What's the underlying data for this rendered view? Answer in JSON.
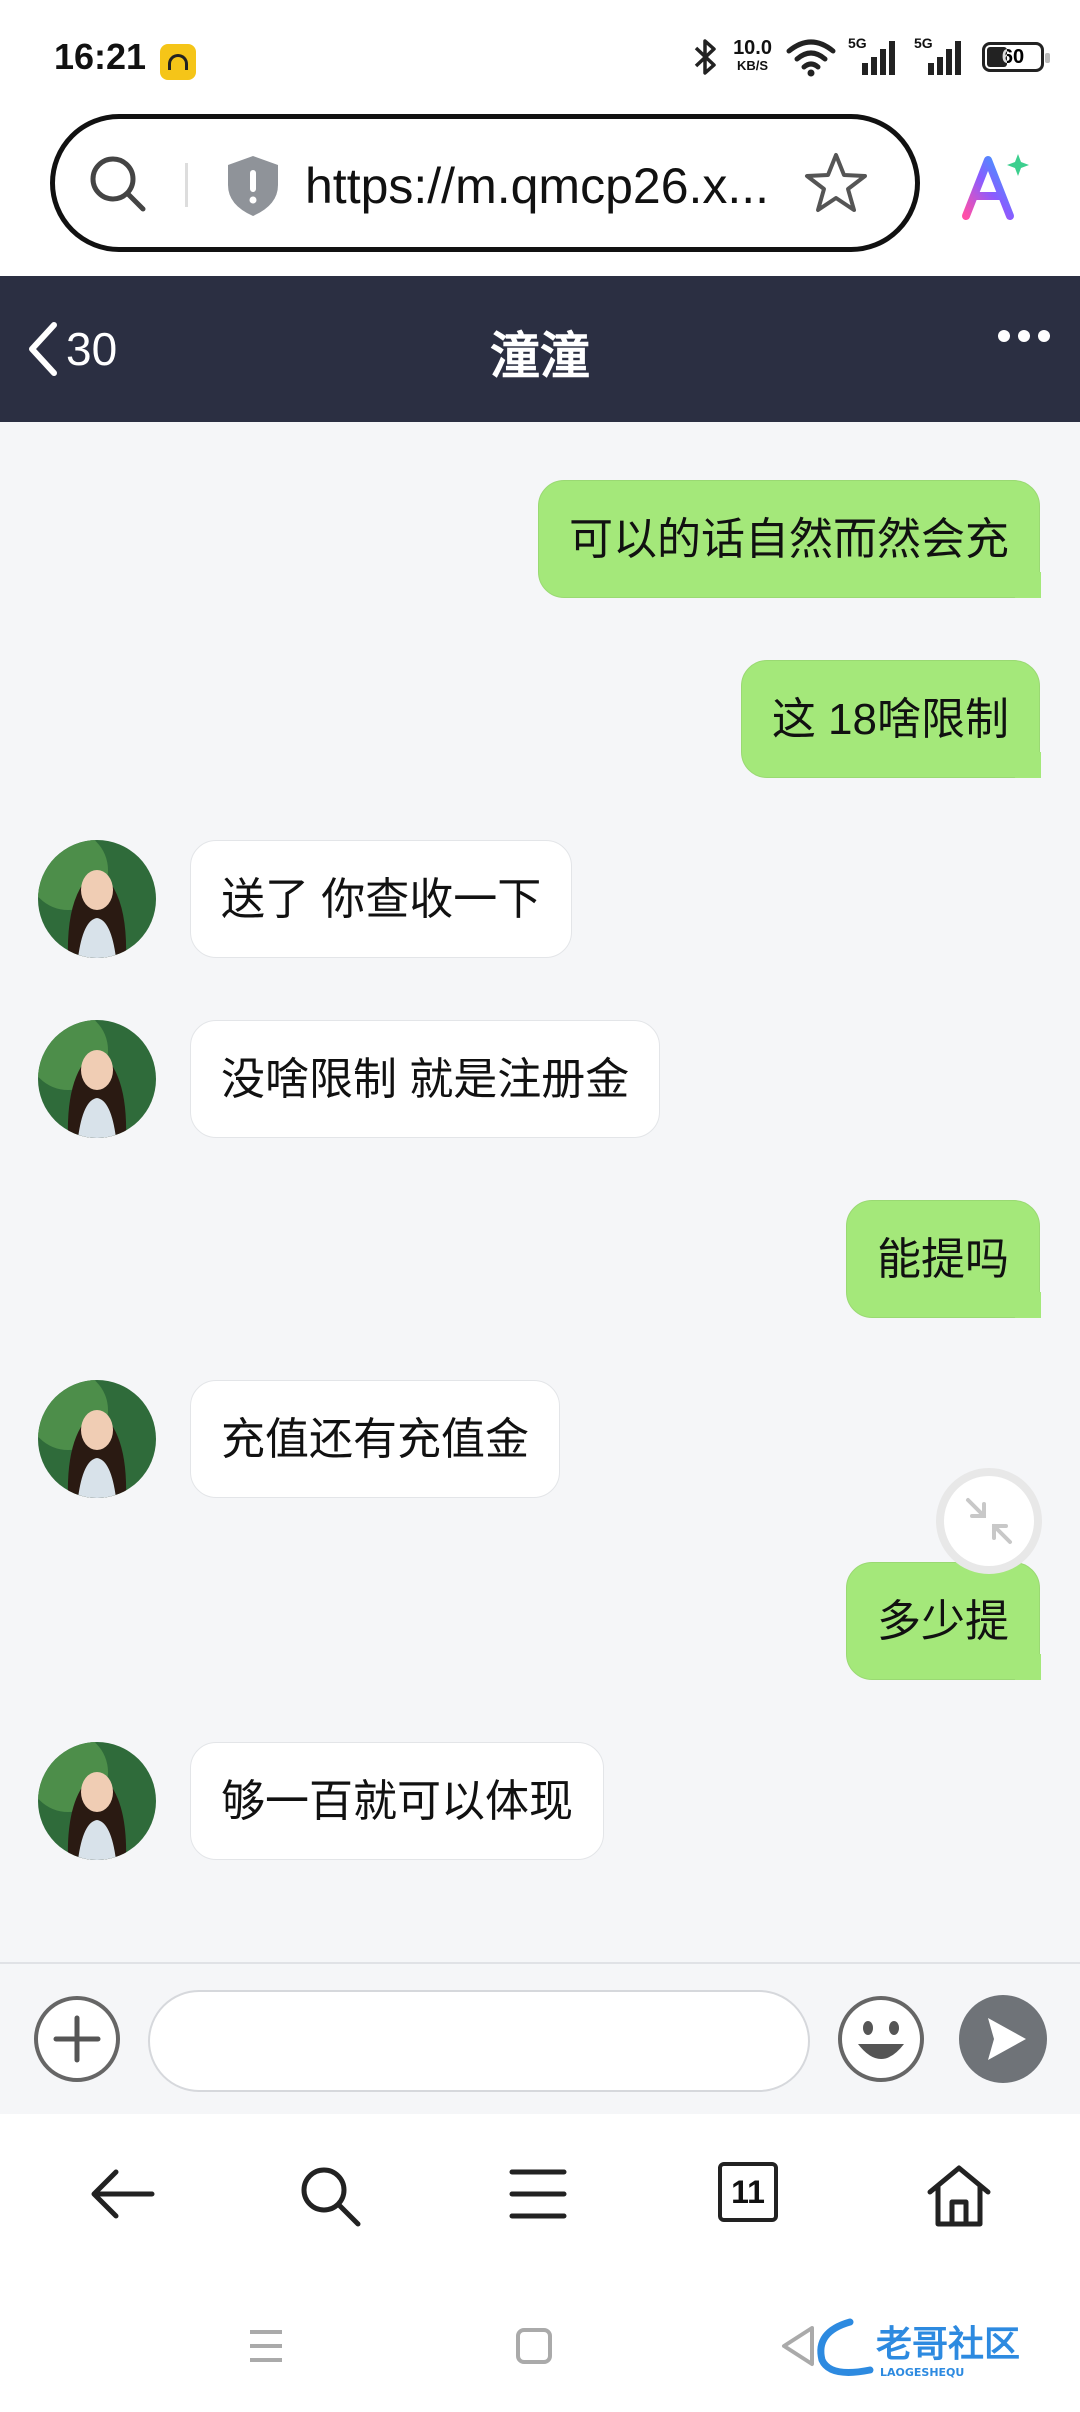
{
  "status_bar": {
    "time": "16:21",
    "network_speed": "10.0",
    "network_speed_unit": "KB/S",
    "signal1_label": "5G",
    "signal2_label": "5G",
    "battery": "60"
  },
  "browser": {
    "url": "https://m.qmcp26.x..."
  },
  "chat": {
    "back_count": "30",
    "title": "潼潼",
    "messages": [
      {
        "side": "me",
        "text": "可以的话自然而然会充"
      },
      {
        "side": "me",
        "text": "这 18啥限制"
      },
      {
        "side": "them",
        "text": "送了 你查收一下"
      },
      {
        "side": "them",
        "text": "没啥限制 就是注册金"
      },
      {
        "side": "me",
        "text": "能提吗"
      },
      {
        "side": "them",
        "text": "充值还有充值金"
      },
      {
        "side": "me",
        "text": "多少提"
      },
      {
        "side": "them",
        "text": "够一百就可以体现"
      }
    ],
    "input_placeholder": ""
  },
  "browser_nav": {
    "tab_count": "11"
  },
  "watermark": {
    "text": "老哥社区",
    "subtext": "LAOGESHEQU"
  },
  "colors": {
    "header_bg": "#2b2f42",
    "my_bubble": "#a4e87a",
    "their_bubble": "#ffffff",
    "chat_bg": "#f5f6f8"
  }
}
